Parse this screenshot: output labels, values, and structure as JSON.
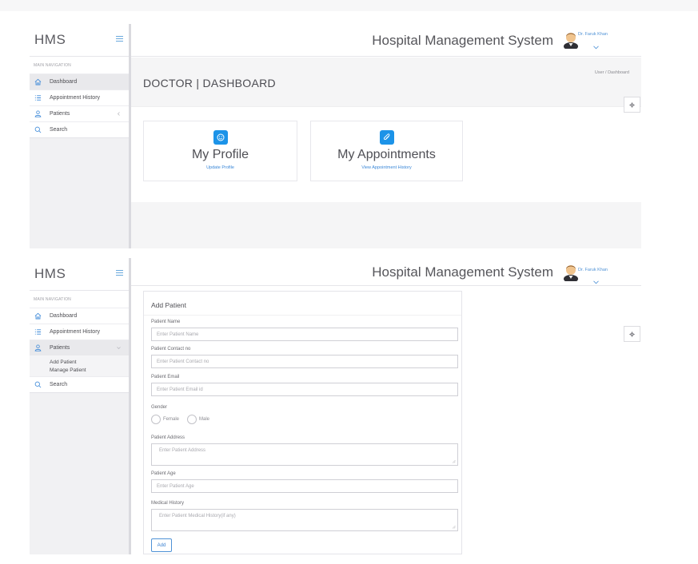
{
  "app": {
    "logo": "HMS",
    "title": "Hospital Management System",
    "user_name": "Dr. Faruk Khan"
  },
  "sidebar": {
    "heading": "MAIN NAVIGATION",
    "items": [
      {
        "label": "Dashboard",
        "icon": "home-icon"
      },
      {
        "label": "Appointment History",
        "icon": "list-icon"
      },
      {
        "label": "Patients",
        "icon": "user-icon"
      },
      {
        "label": "Search",
        "icon": "search-icon"
      }
    ],
    "patients_submenu": [
      "Add Patient",
      "Manage Patient"
    ]
  },
  "dashboard": {
    "page_title": "DOCTOR | DASHBOARD",
    "breadcrumb": "User  /  Dashboard",
    "cards": [
      {
        "title": "My Profile",
        "link": "Update Profile",
        "icon": "smile-icon"
      },
      {
        "title": "My Appointments",
        "link": "View Appointment History",
        "icon": "paperclip-icon"
      }
    ]
  },
  "add_patient": {
    "title": "Add Patient",
    "fields": {
      "name_label": "Patient Name",
      "name_placeholder": "Enter Patient Name",
      "contact_label": "Patient Contact no",
      "contact_placeholder": "Enter Patient Contact no",
      "email_label": "Patient Email",
      "email_placeholder": "Enter Patient Email id",
      "gender_label": "Gender",
      "gender_options": [
        "Female",
        "Male"
      ],
      "address_label": "Patient Address",
      "address_placeholder": "Enter Patient Address",
      "age_label": "Patient Age",
      "age_placeholder": "Enter Patient Age",
      "history_label": "Medical History",
      "history_placeholder": "Enter Patient Medical History(if any)"
    },
    "submit_label": "Add"
  },
  "colors": {
    "accent": "#1c93e8",
    "link": "#3b88d8",
    "sidebar_bg": "#f1f1f3"
  }
}
